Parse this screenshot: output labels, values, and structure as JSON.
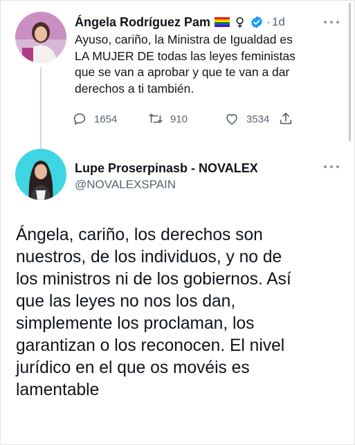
{
  "reply_tweet": {
    "author_name": "Ángela Rodríguez Pam",
    "flag_icon": "rainbow-flag-icon",
    "symbol": "♀",
    "separator": "·",
    "time": "1d",
    "text_lines": [
      "Ayuso, cariño, la Ministra de Igualdad es",
      "LA MUJER DE todas las leyes feministas",
      "que se van a aprobar y que te van a dar",
      "derechos a ti también."
    ],
    "stats": {
      "replies": "1654",
      "retweets": "910",
      "likes": "3534"
    }
  },
  "main_tweet": {
    "author_name": "Lupe Proserpinasb - NOVALEX",
    "handle": "@NOVALEXSPAIN",
    "text_lines": [
      "Ángela, cariño, los derechos son",
      "nuestros, de los individuos, y no de",
      "los ministros ni de los gobiernos. Así",
      "que las leyes no nos los dan,",
      "simplemente los proclaman, los",
      "garantizan o los reconocen. El nivel",
      "jurídico en el que os movéis es",
      "lamentable"
    ]
  },
  "colors": {
    "text_primary": "#0f1419",
    "text_secondary": "#536471",
    "verified_blue": "#1d9bf0",
    "thread_line": "#cfd9de"
  }
}
